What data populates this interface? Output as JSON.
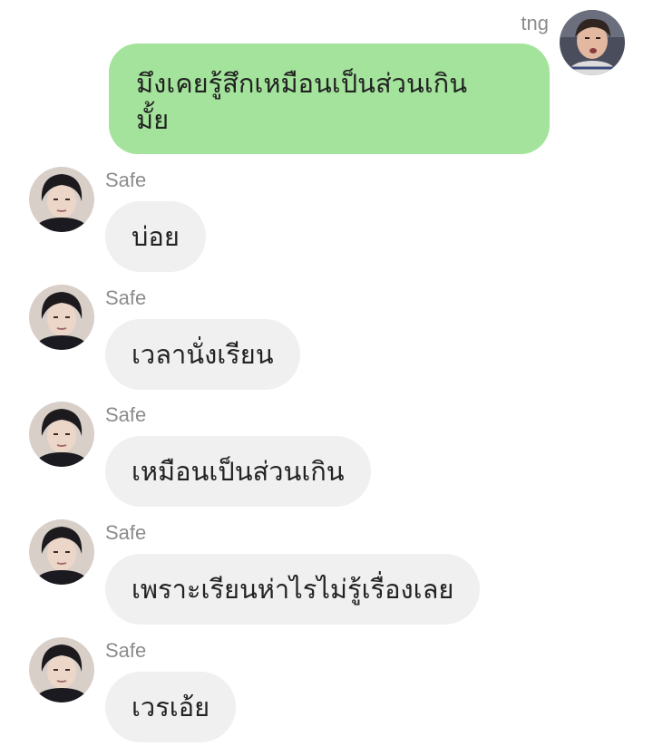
{
  "outgoing": {
    "sender": "tng",
    "text": "มึงเคยรู้สึกเหมือนเป็นส่วนเกิน\nมั้ย"
  },
  "incoming": [
    {
      "sender": "Safe",
      "text": "บ่อย"
    },
    {
      "sender": "Safe",
      "text": "เวลานั่งเรียน"
    },
    {
      "sender": "Safe",
      "text": "เหมือนเป็นส่วนเกิน"
    },
    {
      "sender": "Safe",
      "text": "เพราะเรียนห่าไรไม่รู้เรื่องเลย"
    },
    {
      "sender": "Safe",
      "text": "เวรเอ้ย"
    }
  ],
  "colors": {
    "outgoing_bubble": "#a3e39b",
    "incoming_bubble": "#f0f0f0",
    "sender_name": "#8c8c8c"
  }
}
